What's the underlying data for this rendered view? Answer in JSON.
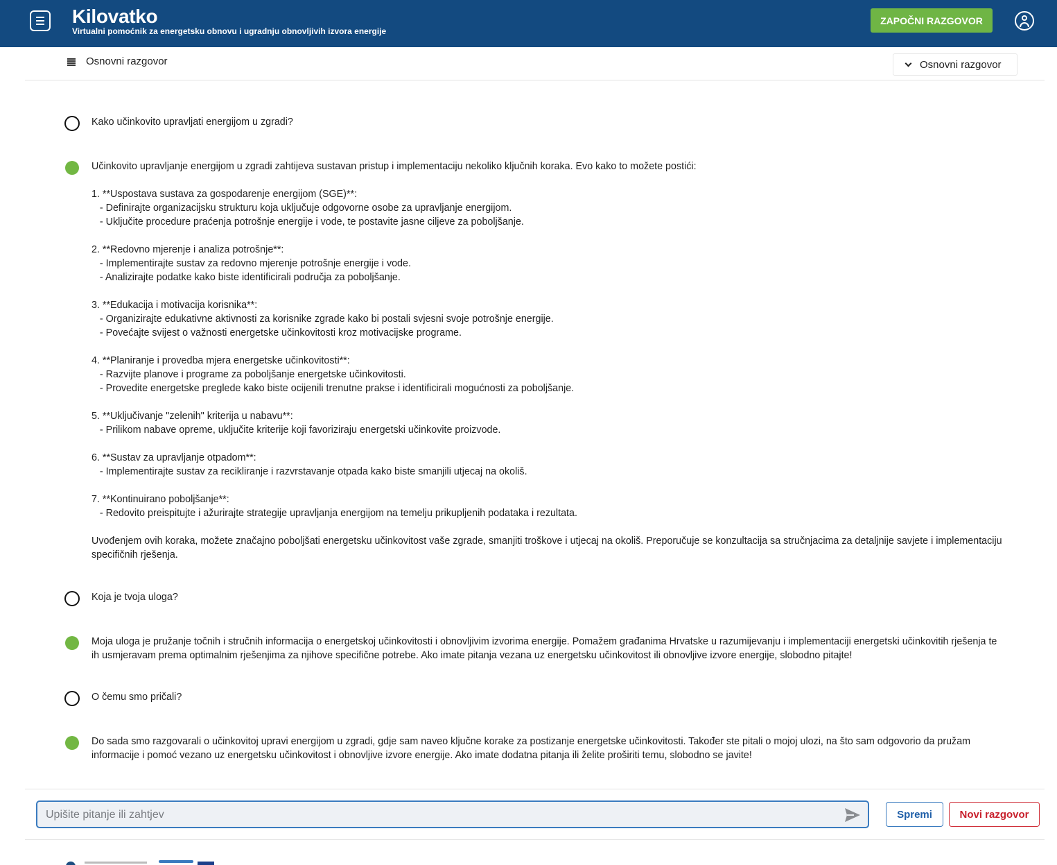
{
  "header": {
    "title": "Kilovatko",
    "subtitle": "Virtualni pomoćnik za energetsku obnovu i ugradnju obnovljivih izvora energije",
    "start_button": "ZAPOČNI RAZGOVOR",
    "brand_color": "#134a80",
    "accent_color": "#6fb545",
    "icons": {
      "menu": "menu-icon",
      "user": "user-account-icon"
    }
  },
  "subheader": {
    "conversation_title": "Osnovni razgovor",
    "select_value": "Osnovni razgovor",
    "icons": {
      "list": "list-icon",
      "chevron": "chevron-down-icon"
    }
  },
  "messages": [
    {
      "role": "user",
      "text": "Kako učinkovito upravljati energijom u zgradi?"
    },
    {
      "role": "bot",
      "text": "Učinkovito upravljanje energijom u zgradi zahtijeva sustavan pristup i implementaciju nekoliko ključnih koraka. Evo kako to možete postići:\n\n1. **Uspostava sustava za gospodarenje energijom (SGE)**:\n   - Definirajte organizacijsku strukturu koja uključuje odgovorne osobe za upravljanje energijom.\n   - Uključite procedure praćenja potrošnje energije i vode, te postavite jasne ciljeve za poboljšanje.\n\n2. **Redovno mjerenje i analiza potrošnje**:\n   - Implementirajte sustav za redovno mjerenje potrošnje energije i vode.\n   - Analizirajte podatke kako biste identificirali područja za poboljšanje.\n\n3. **Edukacija i motivacija korisnika**:\n   - Organizirajte edukativne aktivnosti za korisnike zgrade kako bi postali svjesni svoje potrošnje energije.\n   - Povećajte svijest o važnosti energetske učinkovitosti kroz motivacijske programe.\n\n4. **Planiranje i provedba mjera energetske učinkovitosti**:\n   - Razvijte planove i programe za poboljšanje energetske učinkovitosti.\n   - Provedite energetske preglede kako biste ocijenili trenutne prakse i identificirali mogućnosti za poboljšanje.\n\n5. **Uključivanje \"zelenih\" kriterija u nabavu**:\n   - Prilikom nabave opreme, uključite kriterije koji favoriziraju energetski učinkovite proizvode.\n\n6. **Sustav za upravljanje otpadom**:\n   - Implementirajte sustav za recikliranje i razvrstavanje otpada kako biste smanjili utjecaj na okoliš.\n\n7. **Kontinuirano poboljšanje**:\n   - Redovito preispitujte i ažurirajte strategije upravljanja energijom na temelju prikupljenih podataka i rezultata.\n\nUvođenjem ovih koraka, možete značajno poboljšati energetsku učinkovitost vaše zgrade, smanjiti troškove i utjecaj na okoliš. Preporučuje se konzultacija sa stručnjacima za detaljnije savjete i implementaciju specifičnih rješenja."
    },
    {
      "role": "user",
      "text": "Koja je tvoja uloga?"
    },
    {
      "role": "bot",
      "text": "Moja uloga je pružanje točnih i stručnih informacija o energetskoj učinkovitosti i obnovljivim izvorima energije. Pomažem građanima Hrvatske u razumijevanju i implementaciji energetski učinkovitih rješenja te ih usmjeravam prema optimalnim rješenjima za njihove specifične potrebe. Ako imate pitanja vezana uz energetsku učinkovitost ili obnovljive izvore energije, slobodno pitajte!"
    },
    {
      "role": "user",
      "text": "O čemu smo pričali?"
    },
    {
      "role": "bot",
      "text": "Do sada smo razgovarali o učinkovitoj upravi energijom u zgradi, gdje sam naveo ključne korake za postizanje energetske učinkovitosti. Također ste pitali o mojoj ulozi, na što sam odgovorio da pružam informacije i pomoć vezano uz energetsku učinkovitost i obnovljive izvore energije. Ako imate dodatna pitanja ili želite proširiti temu, slobodno se javite!"
    }
  ],
  "composer": {
    "placeholder": "Upišite pitanje ili zahtjev",
    "value": "",
    "save_button": "Spremi",
    "new_button": "Novi razgovor",
    "icons": {
      "send": "send-icon"
    }
  },
  "colors": {
    "user_marker": "#111111",
    "bot_marker": "#72b743",
    "input_border": "#3a7bbf",
    "danger": "#c8202c"
  }
}
